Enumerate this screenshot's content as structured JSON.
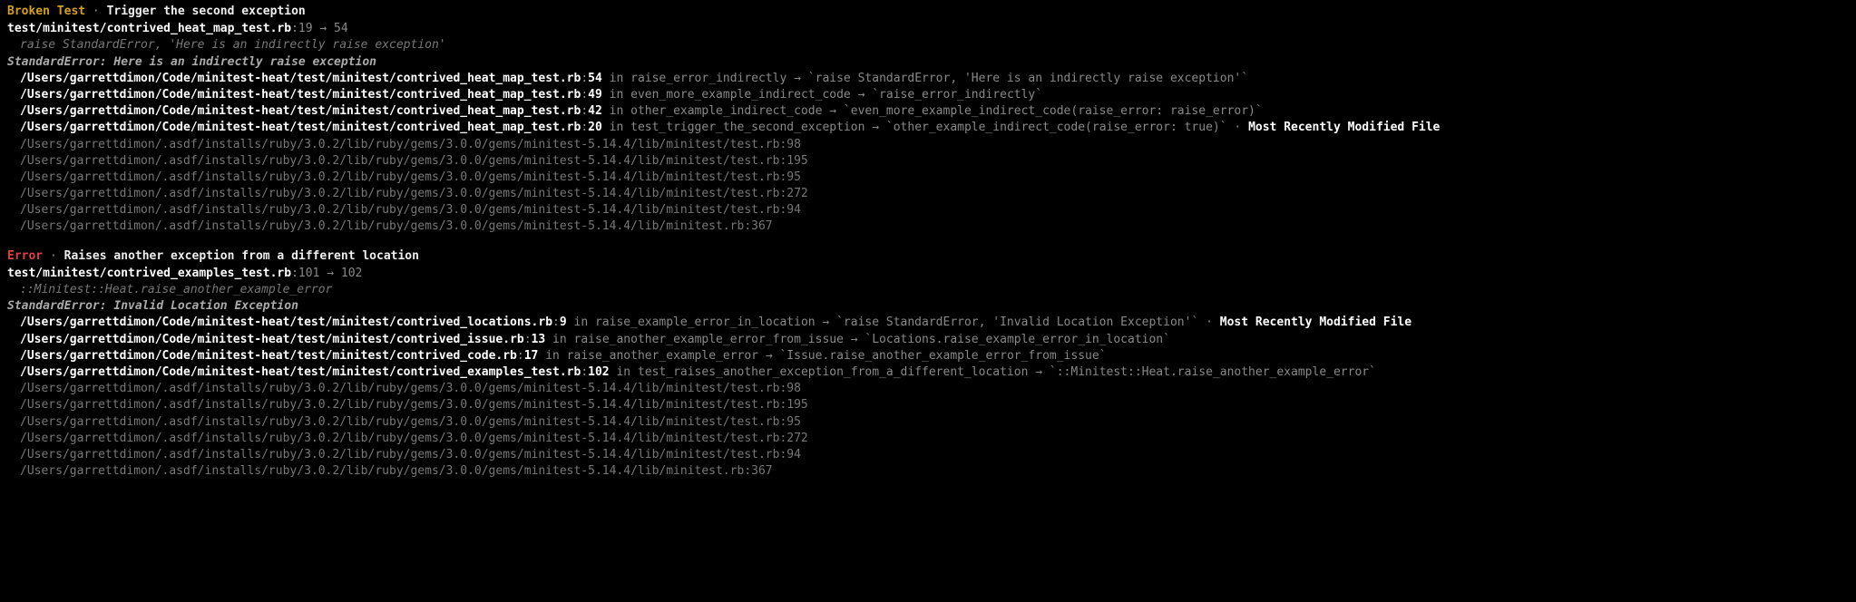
{
  "blocks": [
    {
      "label_class": "broken-test",
      "label": "Broken Test",
      "separator": "·",
      "title": "Trigger the second exception",
      "file_path": "test/minitest/contrived_heat_map_test.rb",
      "file_line_from": "19",
      "arrow": "→",
      "file_line_to": "54",
      "snippet": "raise StandardError, 'Here is an indirectly raise exception'",
      "error_message": "StandardError: Here is an indirectly raise exception",
      "traces": [
        {
          "prefix": "/Users/garrettdimon/Code/minitest-heat/test/minitest/",
          "file": "contrived_heat_map_test.rb",
          "line": "54",
          "context": " in raise_error_indirectly → ",
          "code": "`raise StandardError, 'Here is an indirectly raise exception'`",
          "mrm": false
        },
        {
          "prefix": "/Users/garrettdimon/Code/minitest-heat/test/minitest/",
          "file": "contrived_heat_map_test.rb",
          "line": "49",
          "context": " in even_more_example_indirect_code → ",
          "code": "`raise_error_indirectly`",
          "mrm": false
        },
        {
          "prefix": "/Users/garrettdimon/Code/minitest-heat/test/minitest/",
          "file": "contrived_heat_map_test.rb",
          "line": "42",
          "context": " in other_example_indirect_code → ",
          "code": "`even_more_example_indirect_code(raise_error: raise_error)`",
          "mrm": false
        },
        {
          "prefix": "/Users/garrettdimon/Code/minitest-heat/test/minitest/",
          "file": "contrived_heat_map_test.rb",
          "line": "20",
          "context": " in test_trigger_the_second_exception → ",
          "code": "`other_example_indirect_code(raise_error: true)`",
          "mrm": true
        }
      ],
      "dim_traces": [
        "/Users/garrettdimon/.asdf/installs/ruby/3.0.2/lib/ruby/gems/3.0.0/gems/minitest-5.14.4/lib/minitest/test.rb:98",
        "/Users/garrettdimon/.asdf/installs/ruby/3.0.2/lib/ruby/gems/3.0.0/gems/minitest-5.14.4/lib/minitest/test.rb:195",
        "/Users/garrettdimon/.asdf/installs/ruby/3.0.2/lib/ruby/gems/3.0.0/gems/minitest-5.14.4/lib/minitest/test.rb:95",
        "/Users/garrettdimon/.asdf/installs/ruby/3.0.2/lib/ruby/gems/3.0.0/gems/minitest-5.14.4/lib/minitest/test.rb:272",
        "/Users/garrettdimon/.asdf/installs/ruby/3.0.2/lib/ruby/gems/3.0.0/gems/minitest-5.14.4/lib/minitest/test.rb:94",
        "/Users/garrettdimon/.asdf/installs/ruby/3.0.2/lib/ruby/gems/3.0.0/gems/minitest-5.14.4/lib/minitest.rb:367"
      ],
      "mrm_label": "Most Recently Modified File",
      "mrm_dot": " · "
    },
    {
      "label_class": "error-label",
      "label": "Error",
      "separator": "·",
      "title": "Raises another exception from a different location",
      "file_path": "test/minitest/contrived_examples_test.rb",
      "file_line_from": "101",
      "arrow": "→",
      "file_line_to": "102",
      "snippet": "::Minitest::Heat.raise_another_example_error",
      "error_message": "StandardError: Invalid Location Exception",
      "traces": [
        {
          "prefix": "/Users/garrettdimon/Code/minitest-heat/test/minitest/",
          "file": "contrived_locations.rb",
          "line": "9",
          "context": " in raise_example_error_in_location → ",
          "code": "`raise StandardError, 'Invalid Location Exception'`",
          "mrm": true
        },
        {
          "prefix": "/Users/garrettdimon/Code/minitest-heat/test/minitest/",
          "file": "contrived_issue.rb",
          "line": "13",
          "context": " in raise_another_example_error_from_issue → ",
          "code": "`Locations.raise_example_error_in_location`",
          "mrm": false
        },
        {
          "prefix": "/Users/garrettdimon/Code/minitest-heat/test/minitest/",
          "file": "contrived_code.rb",
          "line": "17",
          "context": " in raise_another_example_error → ",
          "code": "`Issue.raise_another_example_error_from_issue`",
          "mrm": false
        },
        {
          "prefix": "/Users/garrettdimon/Code/minitest-heat/test/minitest/",
          "file": "contrived_examples_test.rb",
          "line": "102",
          "context": " in test_raises_another_exception_from_a_different_location → ",
          "code": "`::Minitest::Heat.raise_another_example_error`",
          "mrm": false
        }
      ],
      "dim_traces": [
        "/Users/garrettdimon/.asdf/installs/ruby/3.0.2/lib/ruby/gems/3.0.0/gems/minitest-5.14.4/lib/minitest/test.rb:98",
        "/Users/garrettdimon/.asdf/installs/ruby/3.0.2/lib/ruby/gems/3.0.0/gems/minitest-5.14.4/lib/minitest/test.rb:195",
        "/Users/garrettdimon/.asdf/installs/ruby/3.0.2/lib/ruby/gems/3.0.0/gems/minitest-5.14.4/lib/minitest/test.rb:95",
        "/Users/garrettdimon/.asdf/installs/ruby/3.0.2/lib/ruby/gems/3.0.0/gems/minitest-5.14.4/lib/minitest/test.rb:272",
        "/Users/garrettdimon/.asdf/installs/ruby/3.0.2/lib/ruby/gems/3.0.0/gems/minitest-5.14.4/lib/minitest/test.rb:94",
        "/Users/garrettdimon/.asdf/installs/ruby/3.0.2/lib/ruby/gems/3.0.0/gems/minitest-5.14.4/lib/minitest.rb:367"
      ],
      "mrm_label": "Most Recently Modified File",
      "mrm_dot": " · "
    }
  ]
}
